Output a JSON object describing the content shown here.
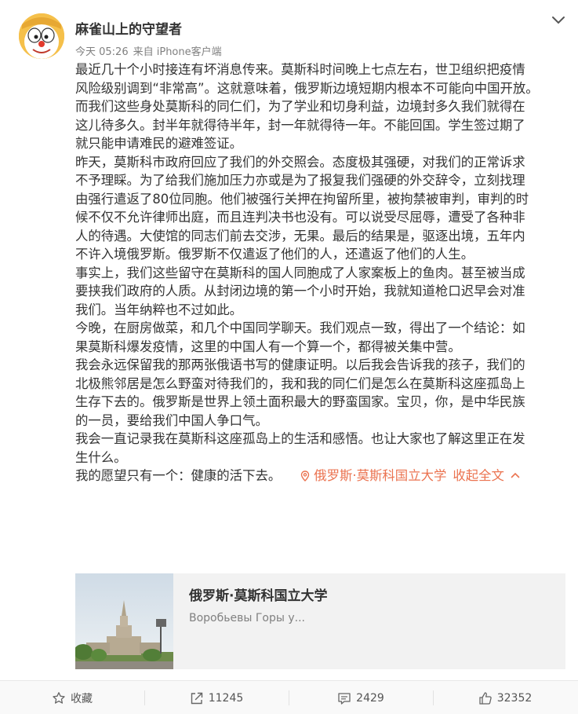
{
  "post": {
    "username": "麻雀山上的守望者",
    "time": "今天 05:26",
    "source": "来自 iPhone客户端",
    "lines": [
      "最近几十个小时接连有坏消息传来。莫斯科时间晚上七点左右，世卫组织把疫情",
      "风险级别调到“非常高”。这就意味着，俄罗斯边境短期内根本不可能向中国开放。",
      "而我们这些身处莫斯科的同仁们，为了学业和切身利益，边境封多久我们就得在",
      "这儿待多久。封半年就得待半年，封一年就得待一年。不能回国。学生签过期了",
      "就只能申请难民的避难签证。",
      "昨天，莫斯科市政府回应了我们的外交照会。态度极其强硬，对我们的正常诉求",
      "不予理睬。为了给我们施加压力亦或是为了报复我们强硬的外交辞令，立刻找理",
      "由强行遣返了80位同胞。他们被强行关押在拘留所里，被拘禁被审判，审判的时",
      "候不仅不允许律师出庭，而且连判决书也没有。可以说受尽屈辱，遭受了各种非",
      "人的待遇。大使馆的同志们前去交涉，无果。最后的结果是，驱逐出境，五年内",
      "不许入境俄罗斯。俄罗斯不仅遣返了他们的人，还遣返了他们的人生。",
      "事实上，我们这些留守在莫斯科的国人同胞成了人家案板上的鱼肉。甚至被当成",
      "要挟我们政府的人质。从封闭边境的第一个小时开始，我就知道枪口迟早会对准",
      "我们。当年纳粹也不过如此。",
      "今晚，在厨房做菜，和几个中国同学聊天。我们观点一致，得出了一个结论：如",
      "果莫斯科爆发疫情，这里的中国人有一个算一个，都得被关集中营。",
      "我会永远保留我的那两张俄语书写的健康证明。以后我会告诉我的孩子，我们的",
      "北极熊邻居是怎么野蛮对待我们的，我和我的同仁们是怎么在莫斯科这座孤岛上",
      "生存下去的。俄罗斯是世界上领土面积最大的野蛮国家。宝贝，你，是中华民族",
      "的一员，要给我们中国人争口气。",
      "我会一直记录我在莫斯科这座孤岛上的生活和感悟。也让大家也了解这里正在发",
      "生什么。"
    ],
    "last_line": "我的愿望只有一个：健康的活下去。",
    "location": "俄罗斯·莫斯科国立大学",
    "collapse_label": "收起全文"
  },
  "place_card": {
    "title": "俄罗斯·莫斯科国立大学",
    "subtitle": "Воробьевы Горы у..."
  },
  "actions": {
    "favorite_label": "收藏",
    "repost_count": "11245",
    "comment_count": "2429",
    "like_count": "32352"
  },
  "colors": {
    "link": "#eb7350",
    "text": "#333333",
    "meta": "#808080"
  },
  "icons": [
    "chevron-down-icon",
    "location-pin-icon",
    "chevron-up-icon",
    "star-icon",
    "repost-icon",
    "comment-icon",
    "thumbs-up-icon"
  ]
}
